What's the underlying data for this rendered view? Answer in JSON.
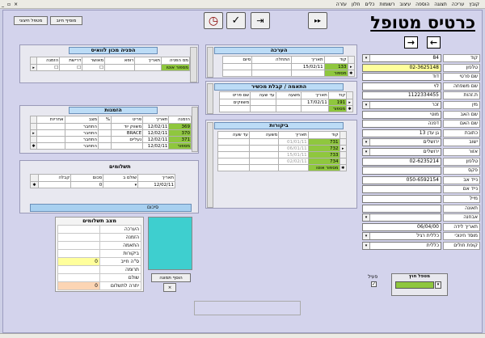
{
  "menubar": {
    "items": [
      "קובץ",
      "עריכה",
      "תצוגה",
      "הוספה",
      "עיצוב",
      "רשומות",
      "כלים",
      "חלון",
      "עזרה"
    ]
  },
  "title": "כרטיס מטופל",
  "toolbar": {
    "add_reception_label": "מוסיף חיוב",
    "add_patient_label": "מטפל חיצוני"
  },
  "fields": [
    {
      "label": "קוד",
      "value": "84",
      "kind": "dd"
    },
    {
      "label": "טלפון",
      "value": "02-3625148",
      "kind": "yellow"
    },
    {
      "label": "שם פרטי",
      "value": "דוד",
      "kind": "plain"
    },
    {
      "label": "שם משפחה",
      "value": "לוי",
      "kind": "plain"
    },
    {
      "label": "ת.זהות",
      "value": "1122334455",
      "kind": "plain"
    },
    {
      "label": "מין",
      "value": "זכר",
      "kind": "dd"
    },
    {
      "label": "שם האב",
      "value": "מוטי",
      "kind": "plain"
    },
    {
      "label": "שם האם",
      "value": "דפנה",
      "kind": "plain"
    },
    {
      "label": "כתובת",
      "value": "גן עדן 13",
      "kind": "plain"
    },
    {
      "label": "ישוב",
      "value": "ירושלים",
      "kind": "dd"
    },
    {
      "label": "אזור",
      "value": "ירושלים",
      "kind": "dd"
    },
    {
      "label": "טלפון",
      "value": "02-6235214",
      "kind": "plain"
    },
    {
      "label": "פקס",
      "value": "",
      "kind": "plain"
    },
    {
      "label": "נייד אב",
      "value": "050-6592154",
      "kind": "plain"
    },
    {
      "label": "נייד אם",
      "value": "",
      "kind": "plain"
    },
    {
      "label": "מייל",
      "value": "",
      "kind": "plain"
    },
    {
      "label": "תאונה",
      "value": "",
      "kind": "plain"
    },
    {
      "label": "אבחנה",
      "value": "",
      "kind": "dd"
    },
    {
      "label": "תאריך לידה",
      "value": "06/04/00",
      "kind": "plain"
    },
    {
      "label": "מוסד חינוכי",
      "value": "כללית רגיל",
      "kind": "dd"
    },
    {
      "label": "קופת חולים",
      "value": "כללית",
      "kind": "dd"
    }
  ],
  "external": {
    "title": "מטפל חוץ",
    "checkbox_label": "פעיל"
  },
  "image": {
    "add_label": "הוסף תמונה",
    "remove_label": "×"
  },
  "referral": {
    "title": "הפניה מכון לוואיס",
    "headers": [
      "מס הפניה",
      "תאריך",
      "רופא",
      "מאושר",
      "דרישת",
      "הזמנה"
    ],
    "rows": [
      [
        "מספור אוטו",
        "",
        "",
        "",
        "",
        ""
      ]
    ]
  },
  "orders": {
    "title": "הזמנות",
    "headers": [
      "הזמנה",
      "תאריך",
      "פריט",
      "%",
      "מצב",
      "אחריות"
    ],
    "rows": [
      [
        "369",
        "12/02/11",
        "משווק יוד",
        "",
        "התחבר",
        ""
      ],
      [
        "370",
        "12/02/11",
        "BRACE",
        "",
        "התחבר",
        ""
      ],
      [
        "371",
        "12/02/11",
        "נעליים",
        "",
        "התחבר",
        ""
      ],
      [
        "מספור",
        "12/02/11",
        "",
        "",
        "התחבר",
        ""
      ]
    ]
  },
  "payments": {
    "title": "תשלומים",
    "headers": [
      "תאריך",
      "שולם ב",
      "סכום",
      "קבלה"
    ],
    "rows": [
      [
        "12/02/11",
        "",
        "0",
        ""
      ]
    ],
    "total_label": "סיכום"
  },
  "pay_status": {
    "title": "מצב תשלומים",
    "rows": [
      [
        "הערכה",
        ""
      ],
      [
        "הזמנה",
        ""
      ],
      [
        "התאמה",
        ""
      ],
      [
        "ביקורות",
        ""
      ],
      [
        "ס\"ה חייב",
        "0"
      ],
      [
        "תרומה",
        ""
      ],
      [
        "שולם",
        ""
      ],
      [
        "יתרה לתשלום",
        "0"
      ]
    ]
  },
  "assessment": {
    "title": "הערכה",
    "headers": [
      "קוד",
      "תאריך",
      "התחלה",
      "סיום"
    ],
    "rows": [
      [
        "133",
        "15/02/11",
        "",
        ""
      ],
      [
        "מספור",
        "",
        "",
        ""
      ]
    ]
  },
  "fitting": {
    "title": "התאמה / קבלת מכשיר",
    "headers": [
      "קוד",
      "תאריך",
      "משעה",
      "עד שעה",
      "שם פריט"
    ],
    "rows": [
      [
        "191",
        "17/02/11",
        "",
        "",
        "משווקים"
      ],
      [
        "מספור",
        "",
        "",
        "",
        ""
      ]
    ]
  },
  "visits": {
    "title": "ביקורות",
    "headers": [
      "קוד",
      "תאריך",
      "משעה",
      "עד שעה"
    ],
    "rows": [
      [
        "731",
        "01/01/11",
        "",
        ""
      ],
      [
        "732",
        "06/01/11",
        "",
        ""
      ],
      [
        "733",
        "15/01/11",
        "",
        ""
      ],
      [
        "734",
        "02/02/11",
        "",
        ""
      ],
      [
        "מספור אוטו",
        "",
        "",
        ""
      ]
    ]
  },
  "colors": {
    "green": "#8fc73e",
    "yellow": "#ffff9c",
    "title_blue": "#bcdcf6",
    "image_teal": "#3ecfcf"
  }
}
